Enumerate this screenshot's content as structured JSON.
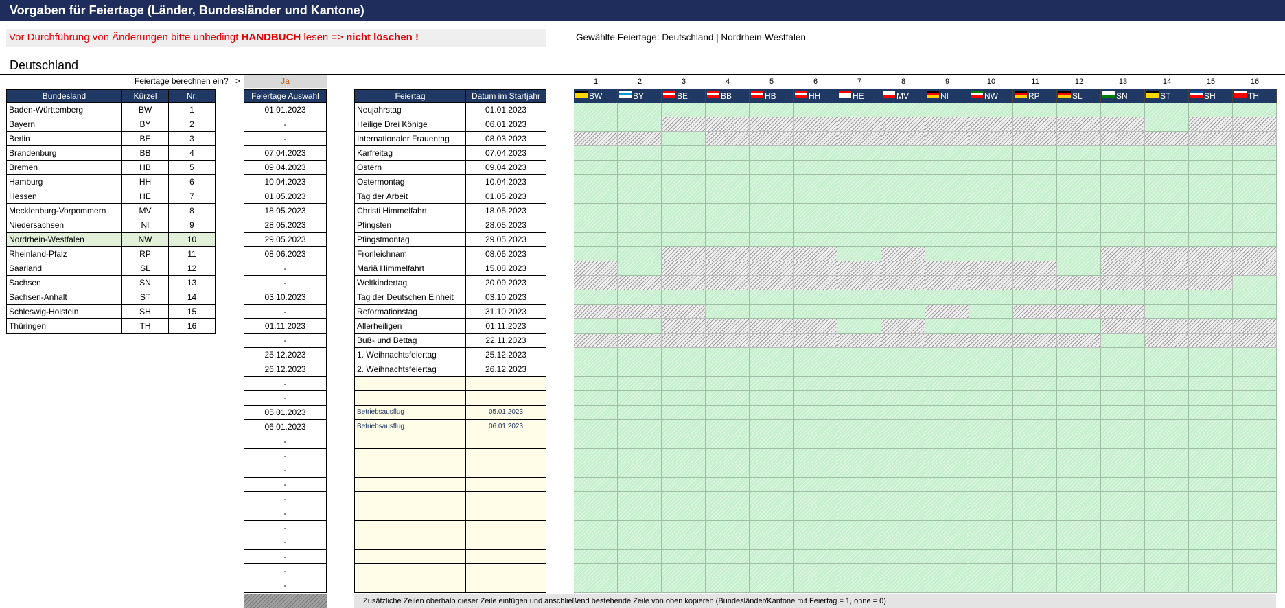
{
  "title": "Vorgaben für Feiertage  (Länder, Bundesländer und Kantone)",
  "warning": {
    "prefix": "Vor Durchführung von Änderungen bitte unbedingt ",
    "handbuch": "HANDBUCH",
    "mid": " lesen => ",
    "end": "nicht löschen !"
  },
  "selected_holidays": "Gewählte Feiertage: Deutschland | Nordrhein-Westfalen",
  "country": "Deutschland",
  "calc_question": "Feiertage berechnen ein? =>",
  "calc_answer": "Ja",
  "states_headers": {
    "name": "Bundesland",
    "abbr": "Kürzel",
    "nr": "Nr."
  },
  "states": [
    {
      "name": "Baden-Württemberg",
      "abbr": "BW",
      "nr": "1"
    },
    {
      "name": "Bayern",
      "abbr": "BY",
      "nr": "2"
    },
    {
      "name": "Berlin",
      "abbr": "BE",
      "nr": "3"
    },
    {
      "name": "Brandenburg",
      "abbr": "BB",
      "nr": "4"
    },
    {
      "name": "Bremen",
      "abbr": "HB",
      "nr": "5"
    },
    {
      "name": "Hamburg",
      "abbr": "HH",
      "nr": "6"
    },
    {
      "name": "Hessen",
      "abbr": "HE",
      "nr": "7"
    },
    {
      "name": "Mecklenburg-Vorpommern",
      "abbr": "MV",
      "nr": "8"
    },
    {
      "name": "Niedersachsen",
      "abbr": "NI",
      "nr": "9"
    },
    {
      "name": "Nordrhein-Westfalen",
      "abbr": "NW",
      "nr": "10"
    },
    {
      "name": "Rheinland-Pfalz",
      "abbr": "RP",
      "nr": "11"
    },
    {
      "name": "Saarland",
      "abbr": "SL",
      "nr": "12"
    },
    {
      "name": "Sachsen",
      "abbr": "SN",
      "nr": "13"
    },
    {
      "name": "Sachsen-Anhalt",
      "abbr": "ST",
      "nr": "14"
    },
    {
      "name": "Schleswig-Holstein",
      "abbr": "SH",
      "nr": "15"
    },
    {
      "name": "Thüringen",
      "abbr": "TH",
      "nr": "16"
    }
  ],
  "selected_state_index": 9,
  "selection_header": "Feiertage Auswahl",
  "selection": [
    "01.01.2023",
    "-",
    "-",
    "07.04.2023",
    "09.04.2023",
    "10.04.2023",
    "01.05.2023",
    "18.05.2023",
    "28.05.2023",
    "29.05.2023",
    "08.06.2023",
    "-",
    "-",
    "03.10.2023",
    "-",
    "01.11.2023",
    "-",
    "25.12.2023",
    "26.12.2023",
    "-",
    "-",
    "05.01.2023",
    "06.01.2023",
    "-",
    "-",
    "-",
    "-",
    "-",
    "-",
    "-",
    "-",
    "-",
    "-",
    "-"
  ],
  "holiday_headers": {
    "name": "Feiertag",
    "date": "Datum im Startjahr"
  },
  "holidays": [
    {
      "name": "Neujahrstag",
      "date": "01.01.2023"
    },
    {
      "name": "Heilige Drei Könige",
      "date": "06.01.2023"
    },
    {
      "name": "Internationaler Frauentag",
      "date": "08.03.2023"
    },
    {
      "name": "Karfreitag",
      "date": "07.04.2023"
    },
    {
      "name": "Ostern",
      "date": "09.04.2023"
    },
    {
      "name": "Ostermontag",
      "date": "10.04.2023"
    },
    {
      "name": "Tag der Arbeit",
      "date": "01.05.2023"
    },
    {
      "name": "Christi Himmelfahrt",
      "date": "18.05.2023"
    },
    {
      "name": "Pfingsten",
      "date": "28.05.2023"
    },
    {
      "name": "Pfingstmontag",
      "date": "29.05.2023"
    },
    {
      "name": "Fronleichnam",
      "date": "08.06.2023"
    },
    {
      "name": "Mariä Himmelfahrt",
      "date": "15.08.2023"
    },
    {
      "name": "Weltkindertag",
      "date": "20.09.2023"
    },
    {
      "name": "Tag der Deutschen Einheit",
      "date": "03.10.2023"
    },
    {
      "name": "Reformationstag",
      "date": "31.10.2023"
    },
    {
      "name": "Allerheiligen",
      "date": "01.11.2023"
    },
    {
      "name": "Buß- und Bettag",
      "date": "22.11.2023"
    },
    {
      "name": "1. Weihnachtsfeiertag",
      "date": "25.12.2023"
    },
    {
      "name": "2. Weihnachtsfeiertag",
      "date": "26.12.2023"
    }
  ],
  "custom_holidays": [
    {
      "name": "",
      "date": ""
    },
    {
      "name": "",
      "date": ""
    },
    {
      "name": "Betriebsausflug",
      "date": "05.01.2023"
    },
    {
      "name": "Betriebsausflug",
      "date": "06.01.2023"
    },
    {
      "name": "",
      "date": ""
    },
    {
      "name": "",
      "date": ""
    },
    {
      "name": "",
      "date": ""
    },
    {
      "name": "",
      "date": ""
    },
    {
      "name": "",
      "date": ""
    },
    {
      "name": "",
      "date": ""
    },
    {
      "name": "",
      "date": ""
    },
    {
      "name": "",
      "date": ""
    },
    {
      "name": "",
      "date": ""
    },
    {
      "name": "",
      "date": ""
    },
    {
      "name": "",
      "date": ""
    }
  ],
  "matrix_columns": [
    {
      "nr": "1",
      "abbr": "BW",
      "flag": [
        "#000000",
        "#ffd700",
        "#ffd700"
      ]
    },
    {
      "nr": "2",
      "abbr": "BY",
      "flag": [
        "#ffffff",
        "#0098d4",
        "#ffffff"
      ]
    },
    {
      "nr": "3",
      "abbr": "BE",
      "flag": [
        "#ff0000",
        "#ffffff",
        "#ff0000"
      ]
    },
    {
      "nr": "4",
      "abbr": "BB",
      "flag": [
        "#ff0000",
        "#ffffff",
        "#ff0000"
      ]
    },
    {
      "nr": "5",
      "abbr": "HB",
      "flag": [
        "#ff0000",
        "#ffffff",
        "#ff0000"
      ]
    },
    {
      "nr": "6",
      "abbr": "HH",
      "flag": [
        "#ff0000",
        "#ffffff",
        "#ff0000"
      ]
    },
    {
      "nr": "7",
      "abbr": "HE",
      "flag": [
        "#ff0000",
        "#ffffff",
        "#ffffff"
      ]
    },
    {
      "nr": "8",
      "abbr": "MV",
      "flag": [
        "#ffffff",
        "#ffffff",
        "#ff0000"
      ]
    },
    {
      "nr": "9",
      "abbr": "NI",
      "flag": [
        "#000000",
        "#ff0000",
        "#ffcc00"
      ]
    },
    {
      "nr": "10",
      "abbr": "NW",
      "flag": [
        "#008000",
        "#ffffff",
        "#ff0000"
      ]
    },
    {
      "nr": "11",
      "abbr": "RP",
      "flag": [
        "#000000",
        "#ff0000",
        "#ffcc00"
      ]
    },
    {
      "nr": "12",
      "abbr": "SL",
      "flag": [
        "#000000",
        "#ff0000",
        "#ffcc00"
      ]
    },
    {
      "nr": "13",
      "abbr": "SN",
      "flag": [
        "#ffffff",
        "#ffffff",
        "#008000"
      ]
    },
    {
      "nr": "14",
      "abbr": "ST",
      "flag": [
        "#000000",
        "#ffd700",
        "#ffd700"
      ]
    },
    {
      "nr": "15",
      "abbr": "SH",
      "flag": [
        "#0050a0",
        "#ffffff",
        "#ff0000"
      ]
    },
    {
      "nr": "16",
      "abbr": "TH",
      "flag": [
        "#ffffff",
        "#ff0000",
        "#ff0000"
      ]
    }
  ],
  "matrix": [
    "1111111111111111",
    "1100000000000100",
    "0010000000000000",
    "1111111111111111",
    "1111111111111111",
    "1111111111111111",
    "1111111111111111",
    "1111111111111111",
    "1111111111111111",
    "1111111111111111",
    "1100001011110000",
    "0100000000010000",
    "0000000000000001",
    "1111111111111111",
    "0001111101000111",
    "1100001011110000",
    "0000000000001000",
    "1111111111111111",
    "1111111111111111",
    "1111111111111111",
    "1111111111111111",
    "1111111111111111",
    "1111111111111111",
    "1111111111111111",
    "1111111111111111",
    "1111111111111111",
    "1111111111111111",
    "1111111111111111",
    "1111111111111111",
    "1111111111111111",
    "1111111111111111",
    "1111111111111111",
    "1111111111111111",
    "1111111111111111"
  ],
  "footer_note": "Zusätzliche Zeilen oberhalb dieser Zeile einfügen und anschließend bestehende Zeile von oben kopieren (Bundesländer/Kantone mit Feiertag = 1, ohne = 0)",
  "colors": {
    "header_navy": "#1f2d5c",
    "table_header": "#1f3864",
    "holiday_green": "#c6efce",
    "no_holiday_grey": "#efefef",
    "custom_yellow": "#fffde7",
    "selected_row": "#e2efd9",
    "warning_red": "#e00000"
  }
}
